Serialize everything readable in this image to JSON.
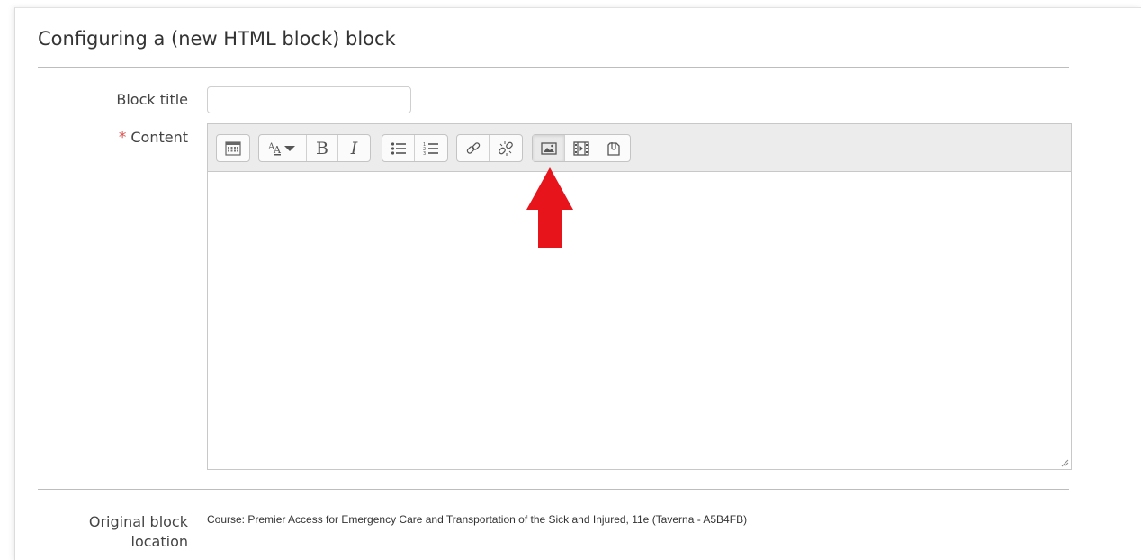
{
  "form": {
    "heading": "Configuring a (new HTML block) block",
    "block_title_label": "Block title",
    "block_title_value": "",
    "content_required_marker": "*",
    "content_label": "Content",
    "original_location_label": "Original block location",
    "original_location_value": "Course: Premier Access for Emergency Care and Transportation of the Sick and Injured, 11e (Taverna - A5B4FB)"
  },
  "toolbar": {
    "groups": [
      {
        "buttons": [
          "show-more-buttons-icon"
        ]
      },
      {
        "buttons": [
          "font-style-dropdown-icon",
          "bold-icon",
          "italic-icon"
        ]
      },
      {
        "buttons": [
          "unordered-list-icon",
          "ordered-list-icon"
        ]
      },
      {
        "buttons": [
          "link-icon",
          "unlink-icon"
        ]
      },
      {
        "buttons": [
          "insert-image-icon",
          "insert-media-icon",
          "manage-files-icon"
        ]
      }
    ],
    "bold_glyph": "B",
    "italic_glyph": "I",
    "font_glyph": "A"
  },
  "annotation": {
    "arrow_color": "#e8141c",
    "points_to": "insert-image-icon"
  },
  "colors": {
    "required": "#d9534f",
    "toolbar_bg": "#ececec"
  }
}
